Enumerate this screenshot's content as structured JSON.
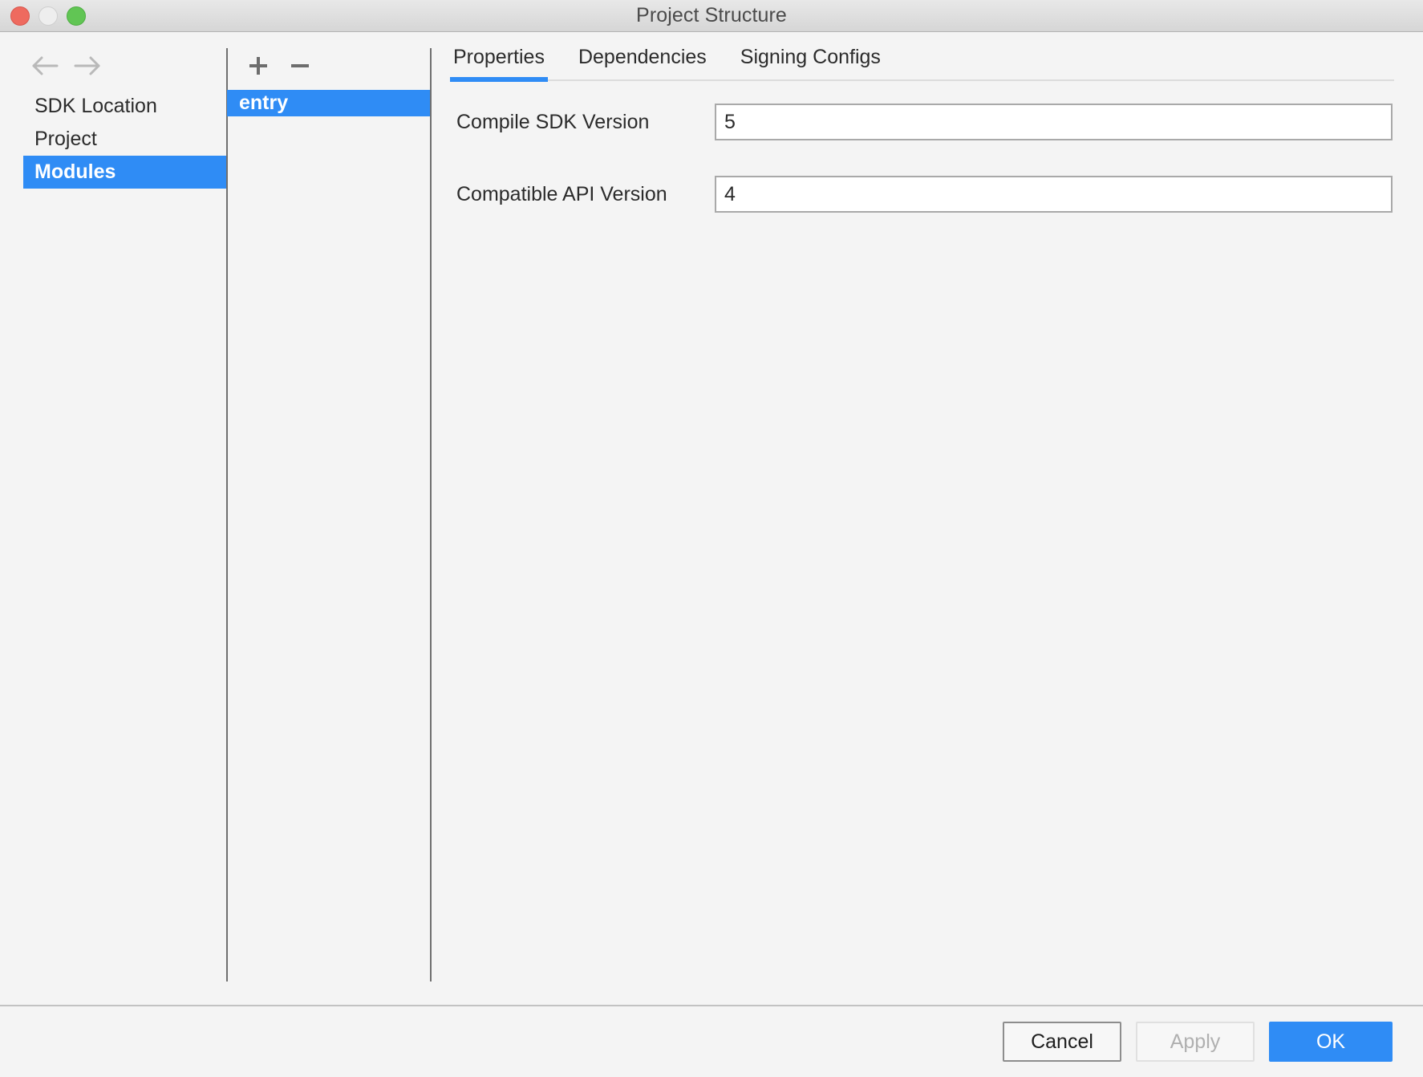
{
  "window": {
    "title": "Project Structure",
    "controls": {
      "close": "close-button",
      "minimize": "minimize-button",
      "zoom": "zoom-button"
    }
  },
  "sidebar": {
    "nav": {
      "back_label": "Back",
      "forward_label": "Forward"
    },
    "items": [
      {
        "label": "SDK Location",
        "selected": false
      },
      {
        "label": "Project",
        "selected": false
      },
      {
        "label": "Modules",
        "selected": true
      }
    ]
  },
  "modules_panel": {
    "toolbar": {
      "add_label": "+",
      "remove_label": "−"
    },
    "items": [
      {
        "label": "entry",
        "selected": true
      }
    ]
  },
  "content": {
    "tabs": [
      {
        "label": "Properties",
        "active": true
      },
      {
        "label": "Dependencies",
        "active": false
      },
      {
        "label": "Signing Configs",
        "active": false
      }
    ],
    "fields": [
      {
        "label": "Compile SDK Version",
        "value": "5",
        "placeholder": ""
      },
      {
        "label": "Compatible API Version",
        "value": "4",
        "placeholder": ""
      }
    ]
  },
  "footer": {
    "cancel_label": "Cancel",
    "apply_label": "Apply",
    "ok_label": "OK"
  },
  "colors": {
    "accent": "#2f8cf5",
    "window_bg": "#f4f4f4",
    "titlebar_top": "#e8e8e8",
    "titlebar_bottom": "#d6d6d6",
    "close": "#ee6a5f",
    "minimize": "#eeeeee",
    "zoom": "#61c554",
    "divider": "#6f6f6f",
    "text": "#2b2b2b"
  }
}
